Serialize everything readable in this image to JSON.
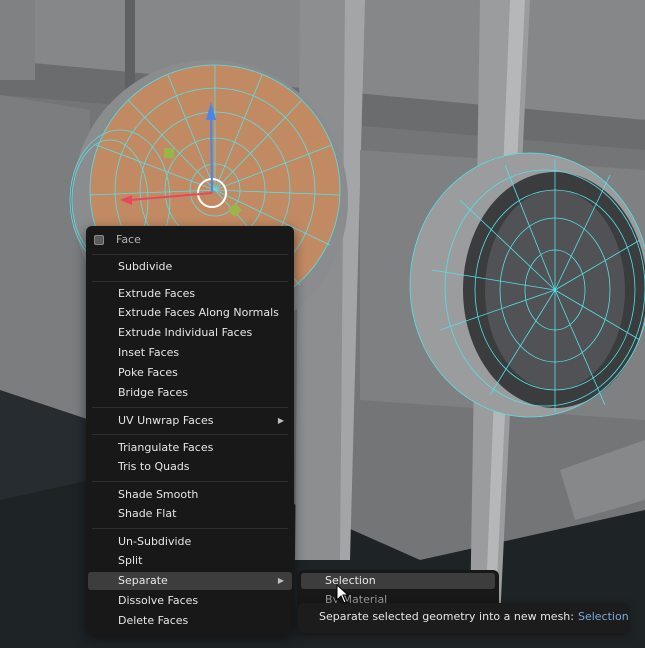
{
  "menu": {
    "title": "Face",
    "items": [
      {
        "label": "Subdivide"
      },
      {
        "label": "Extrude Faces"
      },
      {
        "label": "Extrude Faces Along Normals"
      },
      {
        "label": "Extrude Individual Faces"
      },
      {
        "label": "Inset Faces"
      },
      {
        "label": "Poke Faces"
      },
      {
        "label": "Bridge Faces"
      },
      {
        "label": "UV Unwrap Faces"
      },
      {
        "label": "Triangulate Faces"
      },
      {
        "label": "Tris to Quads"
      },
      {
        "label": "Shade Smooth"
      },
      {
        "label": "Shade Flat"
      },
      {
        "label": "Un-Subdivide"
      },
      {
        "label": "Split"
      },
      {
        "label": "Separate"
      },
      {
        "label": "Dissolve Faces"
      },
      {
        "label": "Delete Faces"
      }
    ]
  },
  "submenu": {
    "items": [
      {
        "label": "Selection"
      },
      {
        "label": "By Material"
      }
    ]
  },
  "tooltip": {
    "text": "Separate selected geometry into a new mesh:",
    "value": "Selection"
  },
  "colors": {
    "menu_bg": "#181818",
    "highlight": "#3d3d3d",
    "wire": "#56e0e8",
    "face_select": "#c9906a",
    "tooltip_value": "#7ea6d8"
  }
}
